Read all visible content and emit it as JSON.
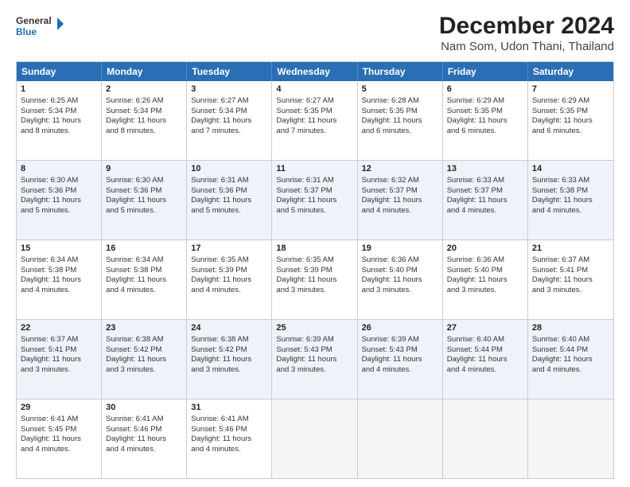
{
  "header": {
    "logo_line1": "General",
    "logo_line2": "Blue",
    "title": "December 2024",
    "subtitle": "Nam Som, Udon Thani, Thailand"
  },
  "calendar": {
    "weekdays": [
      "Sunday",
      "Monday",
      "Tuesday",
      "Wednesday",
      "Thursday",
      "Friday",
      "Saturday"
    ],
    "rows": [
      [
        {
          "day": 1,
          "lines": [
            "Sunrise: 6:25 AM",
            "Sunset: 5:34 PM",
            "Daylight: 11 hours",
            "and 8 minutes."
          ]
        },
        {
          "day": 2,
          "lines": [
            "Sunrise: 6:26 AM",
            "Sunset: 5:34 PM",
            "Daylight: 11 hours",
            "and 8 minutes."
          ]
        },
        {
          "day": 3,
          "lines": [
            "Sunrise: 6:27 AM",
            "Sunset: 5:34 PM",
            "Daylight: 11 hours",
            "and 7 minutes."
          ]
        },
        {
          "day": 4,
          "lines": [
            "Sunrise: 6:27 AM",
            "Sunset: 5:35 PM",
            "Daylight: 11 hours",
            "and 7 minutes."
          ]
        },
        {
          "day": 5,
          "lines": [
            "Sunrise: 6:28 AM",
            "Sunset: 5:35 PM",
            "Daylight: 11 hours",
            "and 6 minutes."
          ]
        },
        {
          "day": 6,
          "lines": [
            "Sunrise: 6:29 AM",
            "Sunset: 5:35 PM",
            "Daylight: 11 hours",
            "and 6 minutes."
          ]
        },
        {
          "day": 7,
          "lines": [
            "Sunrise: 6:29 AM",
            "Sunset: 5:35 PM",
            "Daylight: 11 hours",
            "and 6 minutes."
          ]
        }
      ],
      [
        {
          "day": 8,
          "lines": [
            "Sunrise: 6:30 AM",
            "Sunset: 5:36 PM",
            "Daylight: 11 hours",
            "and 5 minutes."
          ]
        },
        {
          "day": 9,
          "lines": [
            "Sunrise: 6:30 AM",
            "Sunset: 5:36 PM",
            "Daylight: 11 hours",
            "and 5 minutes."
          ]
        },
        {
          "day": 10,
          "lines": [
            "Sunrise: 6:31 AM",
            "Sunset: 5:36 PM",
            "Daylight: 11 hours",
            "and 5 minutes."
          ]
        },
        {
          "day": 11,
          "lines": [
            "Sunrise: 6:31 AM",
            "Sunset: 5:37 PM",
            "Daylight: 11 hours",
            "and 5 minutes."
          ]
        },
        {
          "day": 12,
          "lines": [
            "Sunrise: 6:32 AM",
            "Sunset: 5:37 PM",
            "Daylight: 11 hours",
            "and 4 minutes."
          ]
        },
        {
          "day": 13,
          "lines": [
            "Sunrise: 6:33 AM",
            "Sunset: 5:37 PM",
            "Daylight: 11 hours",
            "and 4 minutes."
          ]
        },
        {
          "day": 14,
          "lines": [
            "Sunrise: 6:33 AM",
            "Sunset: 5:38 PM",
            "Daylight: 11 hours",
            "and 4 minutes."
          ]
        }
      ],
      [
        {
          "day": 15,
          "lines": [
            "Sunrise: 6:34 AM",
            "Sunset: 5:38 PM",
            "Daylight: 11 hours",
            "and 4 minutes."
          ]
        },
        {
          "day": 16,
          "lines": [
            "Sunrise: 6:34 AM",
            "Sunset: 5:38 PM",
            "Daylight: 11 hours",
            "and 4 minutes."
          ]
        },
        {
          "day": 17,
          "lines": [
            "Sunrise: 6:35 AM",
            "Sunset: 5:39 PM",
            "Daylight: 11 hours",
            "and 4 minutes."
          ]
        },
        {
          "day": 18,
          "lines": [
            "Sunrise: 6:35 AM",
            "Sunset: 5:39 PM",
            "Daylight: 11 hours",
            "and 3 minutes."
          ]
        },
        {
          "day": 19,
          "lines": [
            "Sunrise: 6:36 AM",
            "Sunset: 5:40 PM",
            "Daylight: 11 hours",
            "and 3 minutes."
          ]
        },
        {
          "day": 20,
          "lines": [
            "Sunrise: 6:36 AM",
            "Sunset: 5:40 PM",
            "Daylight: 11 hours",
            "and 3 minutes."
          ]
        },
        {
          "day": 21,
          "lines": [
            "Sunrise: 6:37 AM",
            "Sunset: 5:41 PM",
            "Daylight: 11 hours",
            "and 3 minutes."
          ]
        }
      ],
      [
        {
          "day": 22,
          "lines": [
            "Sunrise: 6:37 AM",
            "Sunset: 5:41 PM",
            "Daylight: 11 hours",
            "and 3 minutes."
          ]
        },
        {
          "day": 23,
          "lines": [
            "Sunrise: 6:38 AM",
            "Sunset: 5:42 PM",
            "Daylight: 11 hours",
            "and 3 minutes."
          ]
        },
        {
          "day": 24,
          "lines": [
            "Sunrise: 6:38 AM",
            "Sunset: 5:42 PM",
            "Daylight: 11 hours",
            "and 3 minutes."
          ]
        },
        {
          "day": 25,
          "lines": [
            "Sunrise: 6:39 AM",
            "Sunset: 5:43 PM",
            "Daylight: 11 hours",
            "and 3 minutes."
          ]
        },
        {
          "day": 26,
          "lines": [
            "Sunrise: 6:39 AM",
            "Sunset: 5:43 PM",
            "Daylight: 11 hours",
            "and 4 minutes."
          ]
        },
        {
          "day": 27,
          "lines": [
            "Sunrise: 6:40 AM",
            "Sunset: 5:44 PM",
            "Daylight: 11 hours",
            "and 4 minutes."
          ]
        },
        {
          "day": 28,
          "lines": [
            "Sunrise: 6:40 AM",
            "Sunset: 5:44 PM",
            "Daylight: 11 hours",
            "and 4 minutes."
          ]
        }
      ],
      [
        {
          "day": 29,
          "lines": [
            "Sunrise: 6:41 AM",
            "Sunset: 5:45 PM",
            "Daylight: 11 hours",
            "and 4 minutes."
          ]
        },
        {
          "day": 30,
          "lines": [
            "Sunrise: 6:41 AM",
            "Sunset: 5:46 PM",
            "Daylight: 11 hours",
            "and 4 minutes."
          ]
        },
        {
          "day": 31,
          "lines": [
            "Sunrise: 6:41 AM",
            "Sunset: 5:46 PM",
            "Daylight: 11 hours",
            "and 4 minutes."
          ]
        },
        {
          "day": null,
          "lines": []
        },
        {
          "day": null,
          "lines": []
        },
        {
          "day": null,
          "lines": []
        },
        {
          "day": null,
          "lines": []
        }
      ]
    ]
  }
}
